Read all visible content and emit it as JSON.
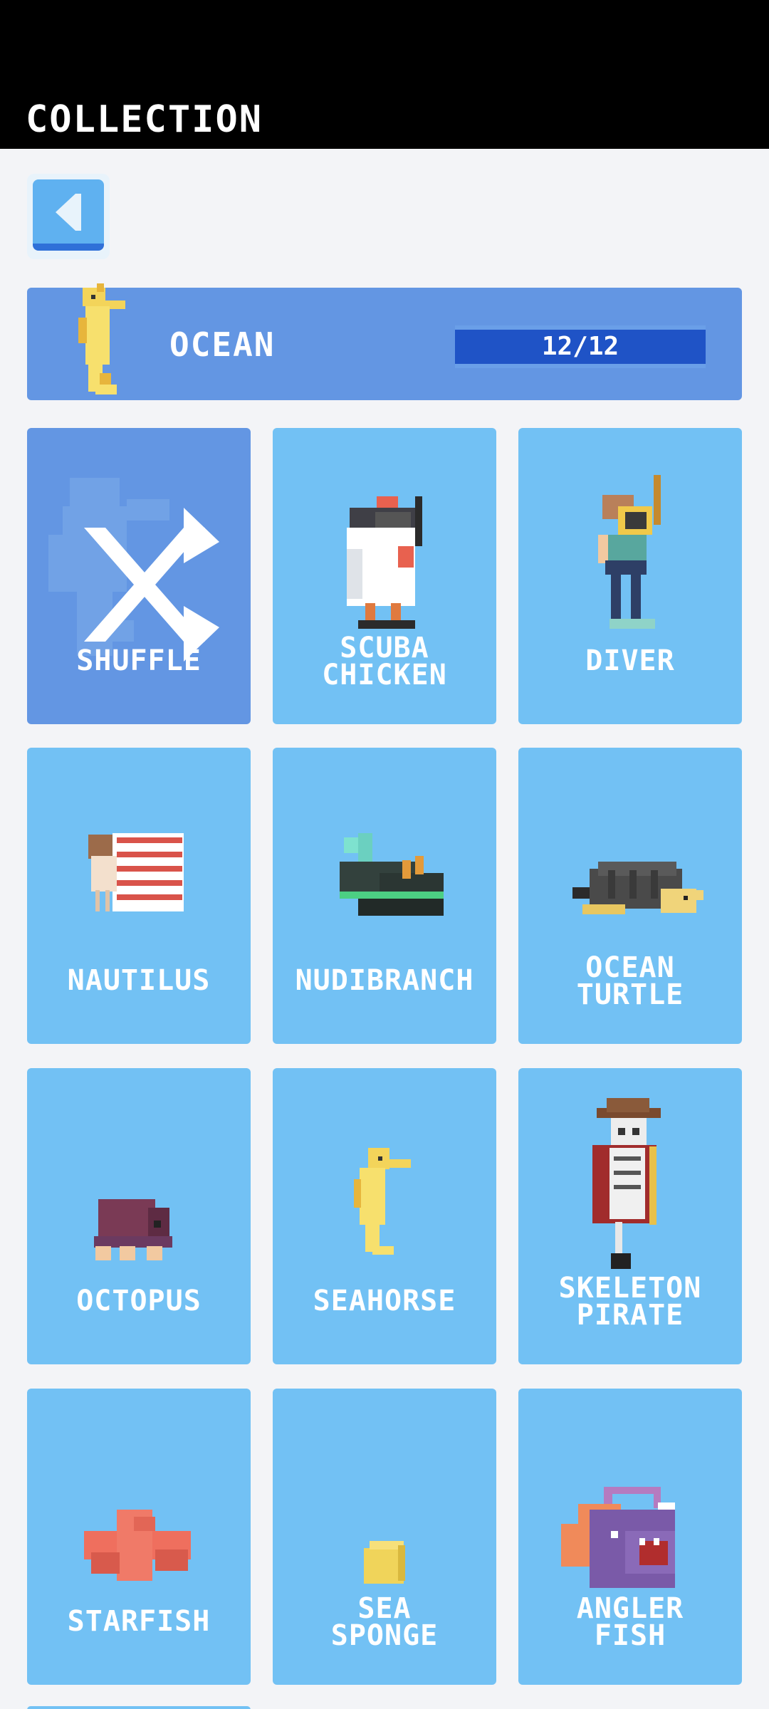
{
  "header": {
    "title": "COLLECTION"
  },
  "back": {
    "label": "back"
  },
  "category": {
    "name": "OCEAN",
    "progress_text": "12/12",
    "collected": 12,
    "total": 12
  },
  "tiles": [
    {
      "name": "SHUFFLE",
      "selected": true
    },
    {
      "name": "SCUBA\nCHICKEN"
    },
    {
      "name": "DIVER"
    },
    {
      "name": "NAUTILUS"
    },
    {
      "name": "NUDIBRANCH"
    },
    {
      "name": "OCEAN\nTURTLE"
    },
    {
      "name": "OCTOPUS"
    },
    {
      "name": "SEAHORSE"
    },
    {
      "name": "SKELETON\nPIRATE"
    },
    {
      "name": "STARFISH"
    },
    {
      "name": "SEA\nSPONGE"
    },
    {
      "name": "ANGLER\nFISH"
    }
  ],
  "colors": {
    "tile": "#72c1f4",
    "selected_tile": "#6396e3",
    "progress_fill": "#1f53c6",
    "header_bg": "#000000"
  }
}
